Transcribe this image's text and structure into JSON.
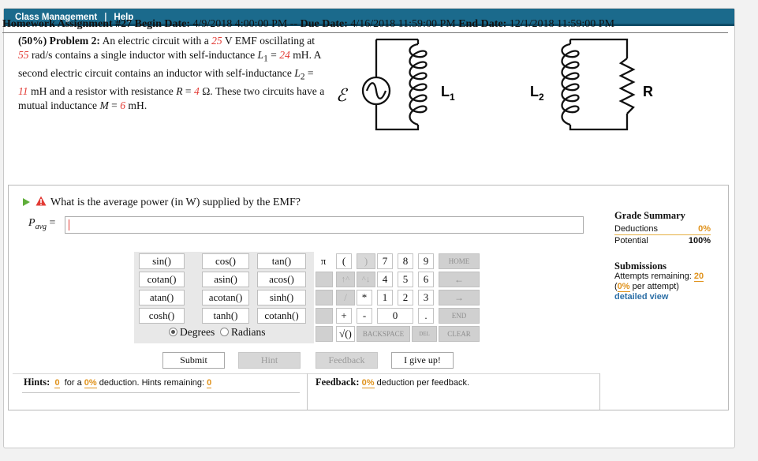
{
  "menu": {
    "class_management": "Class Management",
    "separator": "|",
    "help": "Help"
  },
  "assignment": {
    "title": "Homework Assignment #27",
    "begin_label": "Begin Date:",
    "begin_value": "4/9/2018 4:00:00 PM --",
    "due_label": "Due Date:",
    "due_value": "4/16/2018 11:59:00 PM",
    "end_label": "End Date:",
    "end_value": "12/1/2018 11:59:00 PM"
  },
  "problem": {
    "header": "(50%) Problem 2:",
    "t1": " An electric circuit with a ",
    "emf": "25",
    "t2": " V EMF oscillating at ",
    "omega": "55",
    "t3": " rad/s contains a single inductor with self-inductance ",
    "L1_sym": "L",
    "L1_sub": "1",
    "t4": " = ",
    "L1": "24",
    "t5": " mH. A second electric circuit contains an inductor with self-inductance ",
    "L2_sym": "L",
    "L2_sub": "2",
    "t6": " = ",
    "L2": "11",
    "t7": " mH and a resistor with resistance ",
    "R_sym": "R",
    "t8": " = ",
    "R": "4",
    "t9": " Ω. These two circuits have a mutual inductance ",
    "M_sym": "M",
    "t10": " = ",
    "M": "6",
    "t11": " mH."
  },
  "circuit": {
    "emf_symbol": "ℰ",
    "L1_label": "L",
    "L1_sub": "1",
    "L2_label": "L",
    "L2_sub": "2",
    "R_label": "R"
  },
  "question": {
    "text": "What is the average power (in W) supplied by the EMF?",
    "var": "P",
    "var_sub": "avg",
    "eq": "=",
    "answer_value": ""
  },
  "grade_summary": {
    "title": "Grade Summary",
    "deductions_label": "Deductions",
    "deductions_value": "0%",
    "potential_label": "Potential",
    "potential_value": "100%"
  },
  "submissions": {
    "title": "Submissions",
    "attempts_label": "Attempts remaining:",
    "attempts_value": "20",
    "per_attempt_pct": "0%",
    "per_attempt_suffix": " per attempt)",
    "detailed_view": "detailed view"
  },
  "keypad": {
    "functions": [
      [
        "sin()",
        "cos()",
        "tan()"
      ],
      [
        "cotan()",
        "asin()",
        "acos()"
      ],
      [
        "atan()",
        "acotan()",
        "sinh()"
      ],
      [
        "cosh()",
        "tanh()",
        "cotanh()"
      ]
    ],
    "degrees": "Degrees",
    "radians": "Radians",
    "pi": "π",
    "lparen": "(",
    "rparen": ")",
    "up": "↑^",
    "uparrow": "^↓",
    "slash": "/",
    "star": "*",
    "plus": "+",
    "minus": "-",
    "sqrt": "√()",
    "digits": [
      "7",
      "8",
      "9",
      "4",
      "5",
      "6",
      "1",
      "2",
      "3",
      "0"
    ],
    "dot": ".",
    "home": "HOME",
    "left": "←",
    "right": "→",
    "end": "END",
    "backspace": "BACKSPACE",
    "del": "DEL",
    "clear": "CLEAR"
  },
  "buttons": {
    "submit": "Submit",
    "hint": "Hint",
    "feedback": "Feedback",
    "give_up": "I give up!"
  },
  "hints": {
    "label": "Hints:",
    "count": "0",
    "for_a": "for a",
    "pct": "0%",
    "deduction": "deduction. Hints remaining:",
    "remaining": "0"
  },
  "feedback": {
    "label": "Feedback:",
    "pct": "0%",
    "suffix": "deduction per feedback."
  },
  "colors": {
    "topbar": "#1b6a8c",
    "red_value": "#e23b35",
    "orange": "#e0921b",
    "link_blue": "#2c6fa6",
    "play_green": "#5fae3a"
  }
}
